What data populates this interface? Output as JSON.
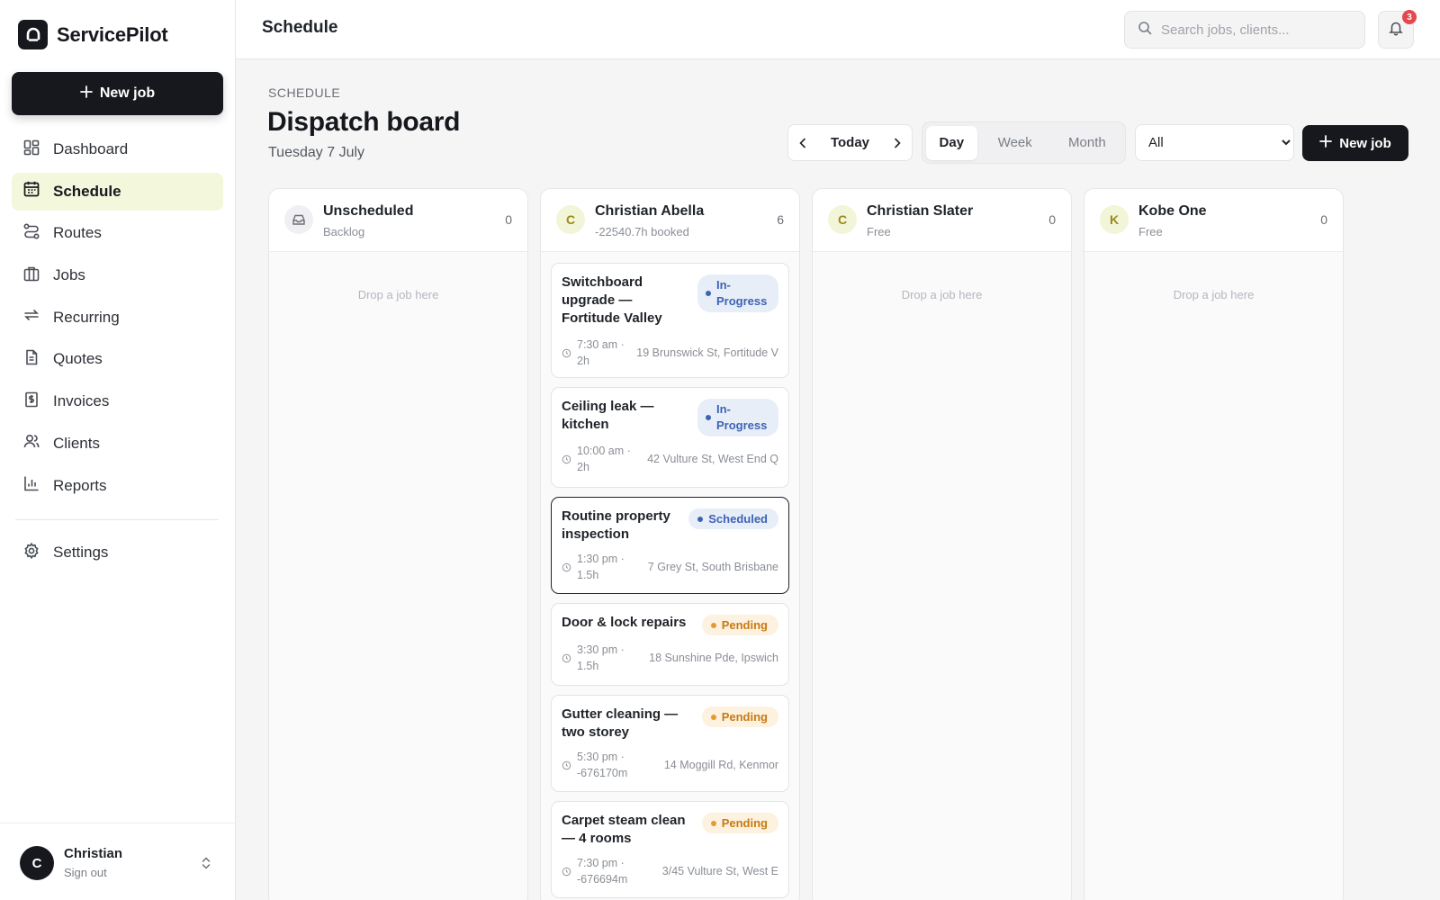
{
  "app": {
    "name": "ServicePilot",
    "new_job_label": "New job"
  },
  "sidebar": {
    "items": [
      {
        "label": "Dashboard",
        "icon": "dashboard-icon",
        "active": false
      },
      {
        "label": "Schedule",
        "icon": "calendar-icon",
        "active": true
      },
      {
        "label": "Routes",
        "icon": "route-icon",
        "active": false
      },
      {
        "label": "Jobs",
        "icon": "briefcase-icon",
        "active": false
      },
      {
        "label": "Recurring",
        "icon": "repeat-icon",
        "active": false
      },
      {
        "label": "Quotes",
        "icon": "document-icon",
        "active": false
      },
      {
        "label": "Invoices",
        "icon": "invoice-icon",
        "active": false
      },
      {
        "label": "Clients",
        "icon": "users-icon",
        "active": false
      },
      {
        "label": "Reports",
        "icon": "bar-chart-icon",
        "active": false
      }
    ],
    "settings_label": "Settings",
    "user": {
      "initial": "C",
      "name": "Christian",
      "sign_out": "Sign out"
    }
  },
  "topbar": {
    "title": "Schedule",
    "search_placeholder": "Search jobs, clients...",
    "notification_count": "3"
  },
  "header": {
    "eyebrow": "SCHEDULE",
    "title": "Dispatch board",
    "date": "Tuesday 7 July",
    "today_label": "Today",
    "views": [
      "Day",
      "Week",
      "Month"
    ],
    "active_view": "Day",
    "filter_value": "All",
    "new_job_label": "New job"
  },
  "columns": [
    {
      "name": "Unscheduled",
      "sub": "Backlog",
      "count": "0",
      "avatar": "",
      "drop_hint": "Drop a job here"
    },
    {
      "name": "Christian Abella",
      "sub": "-22540.7h booked",
      "count": "6",
      "avatar": "C"
    },
    {
      "name": "Christian Slater",
      "sub": "Free",
      "count": "0",
      "avatar": "C",
      "drop_hint": "Drop a job here"
    },
    {
      "name": "Kobe One",
      "sub": "Free",
      "count": "0",
      "avatar": "K",
      "drop_hint": "Drop a job here"
    }
  ],
  "jobs": [
    {
      "title": "Switchboard upgrade — Fortitude Valley",
      "status": "In-Progress",
      "when": "7:30 am · 2h",
      "address": "19 Brunswick St, Fortitude V"
    },
    {
      "title": "Ceiling leak — kitchen",
      "status": "In-Progress",
      "when": "10:00 am · 2h",
      "address": "42 Vulture St, West End Q"
    },
    {
      "title": "Routine property inspection",
      "status": "Scheduled",
      "when": "1:30 pm · 1.5h",
      "address": "7 Grey St, South Brisbane"
    },
    {
      "title": "Door & lock repairs",
      "status": "Pending",
      "when": "3:30 pm · 1.5h",
      "address": "18 Sunshine Pde, Ipswich"
    },
    {
      "title": "Gutter cleaning — two storey",
      "status": "Pending",
      "when": "5:30 pm · -676170m",
      "address": "14 Moggill Rd, Kenmor"
    },
    {
      "title": "Carpet steam clean — 4 rooms",
      "status": "Pending",
      "when": "7:30 pm · -676694m",
      "address": "3/45 Vulture St, West E"
    }
  ],
  "colors": {
    "accent": "#16181d",
    "active_nav": "#f3f7dc",
    "progress": "#3d63b5",
    "pending": "#c77a12"
  }
}
